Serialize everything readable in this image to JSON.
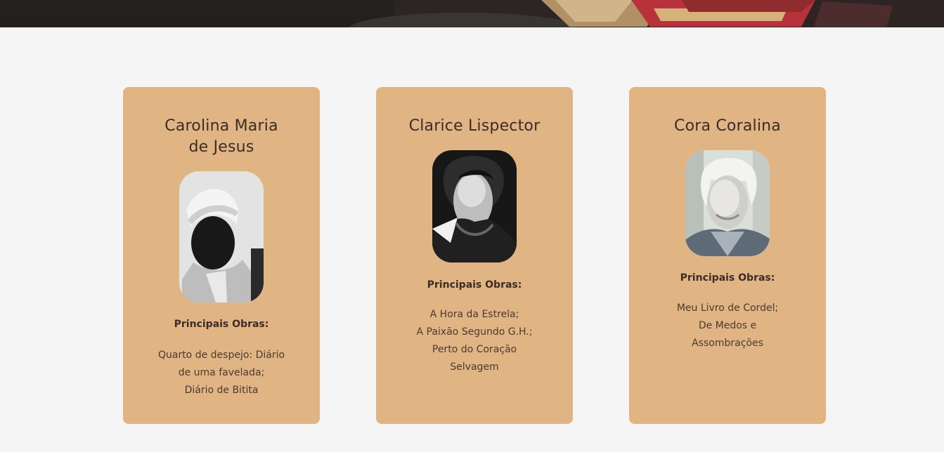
{
  "hero": {
    "background_color": "#24201f"
  },
  "section": {
    "background_color": "#f5f5f5",
    "card_color": "#e0b483",
    "text_color": "#3b2c27"
  },
  "authors": [
    {
      "name_line1": "Carolina Maria",
      "name_line2": "de Jesus",
      "portrait": "author-portrait-icon",
      "works_heading": "Principais Obras:",
      "works_line1": "Quarto de despejo: Diário",
      "works_line2": "de uma favelada;",
      "works_line3": "Diário de Bitita",
      "works_line4": ""
    },
    {
      "name_line1": "Clarice Lispector",
      "name_line2": "",
      "portrait": "author-portrait-icon",
      "works_heading": "Principais Obras:",
      "works_line1": "A Hora da Estrela;",
      "works_line2": "A Paixão Segundo G.H.;",
      "works_line3": "Perto do Coração",
      "works_line4": "Selvagem"
    },
    {
      "name_line1": "Cora Coralina",
      "name_line2": "",
      "portrait": "author-portrait-icon",
      "works_heading": "Principais Obras:",
      "works_line1": "Meu Livro de Cordel;",
      "works_line2": "De Medos e",
      "works_line3": "Assombrações",
      "works_line4": ""
    }
  ]
}
